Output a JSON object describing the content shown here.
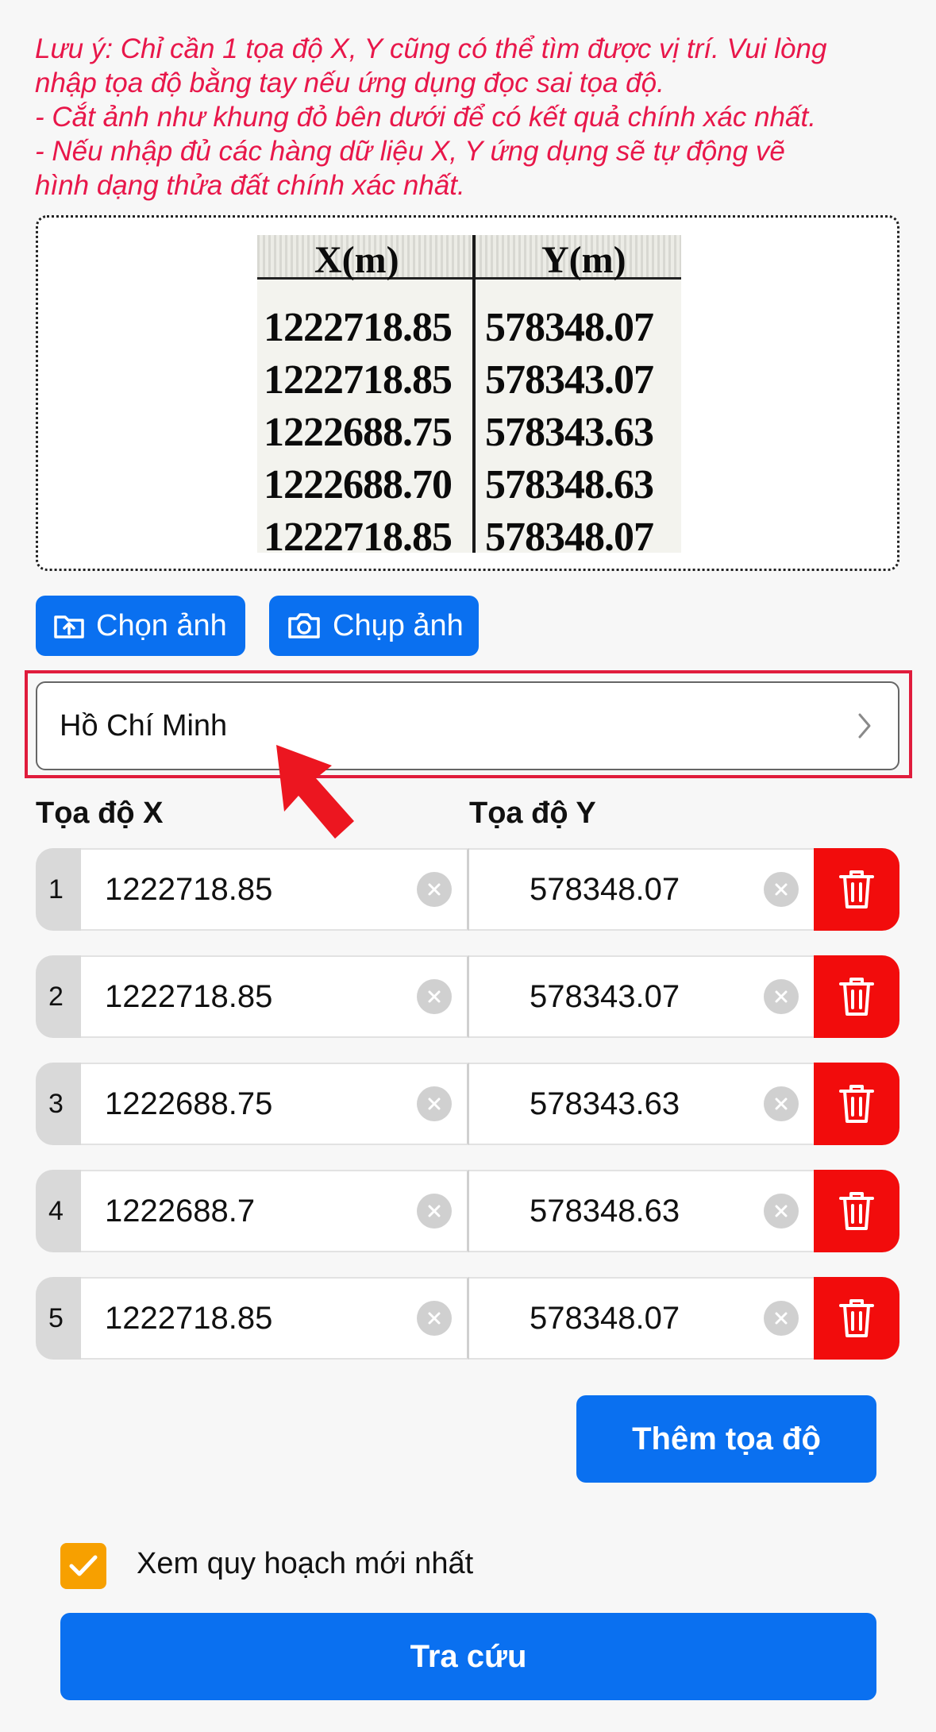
{
  "note": {
    "lines": [
      "Lưu ý: Chỉ cần 1 tọa độ X, Y cũng có thể tìm được vị trí. Vui lòng",
      "nhập tọa độ bằng tay nếu ứng dụng đọc sai tọa độ.",
      "- Cắt ảnh như khung đỏ bên dưới để có kết quả chính xác nhất.",
      "- Nếu nhập đủ các hàng dữ liệu X, Y ứng dụng sẽ tự động vẽ",
      "hình dạng thửa đất chính xác nhất."
    ]
  },
  "sample_image": {
    "header_x": "X(m)",
    "header_y": "Y(m)",
    "x_values": [
      "1222718.85",
      "1222718.85",
      "1222688.75",
      "1222688.70",
      "1222718.85"
    ],
    "y_values": [
      "578348.07",
      "578343.07",
      "578343.63",
      "578348.63",
      "578348.07"
    ]
  },
  "buttons": {
    "choose_image": "Chọn ảnh",
    "capture_image": "Chụp ảnh",
    "add_coordinate": "Thêm tọa độ",
    "search": "Tra cứu"
  },
  "province": {
    "value": "Hồ Chí Minh"
  },
  "columns": {
    "x_label": "Tọa độ X",
    "y_label": "Tọa độ Y"
  },
  "rows": [
    {
      "index": "1",
      "x": "1222718.85",
      "y": "578348.07"
    },
    {
      "index": "2",
      "x": "1222718.85",
      "y": "578343.07"
    },
    {
      "index": "3",
      "x": "1222688.75",
      "y": "578343.63"
    },
    {
      "index": "4",
      "x": "1222688.7",
      "y": "578348.63"
    },
    {
      "index": "5",
      "x": "1222718.85",
      "y": "578348.07"
    }
  ],
  "latest_plan": {
    "label": "Xem quy hoạch mới nhất",
    "checked": true
  },
  "icons": {
    "choose": "upload-folder-icon",
    "capture": "camera-icon",
    "province": "chevron-right-icon",
    "clear": "clear-circle-icon",
    "delete": "trash-icon",
    "check": "checkmark-icon",
    "pointer": "red-arrow-icon"
  },
  "colors": {
    "note_text": "#e8174a",
    "primary": "#0a70f0",
    "delete": "#f20c0c",
    "checkbox": "#f7a000",
    "highlight": "#e01c3c"
  }
}
